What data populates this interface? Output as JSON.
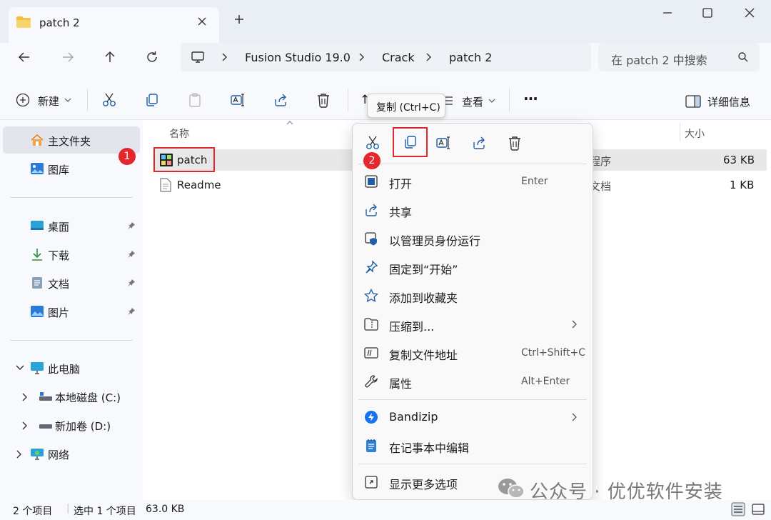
{
  "window": {
    "tab_title": "patch 2",
    "new_tab_symbol": "+"
  },
  "address": {
    "crumbs": [
      "Fusion Studio 19.0",
      "Crack",
      "patch 2"
    ],
    "search_placeholder": "在 patch 2 中搜索"
  },
  "toolbar": {
    "new_label": "新建",
    "sort_label": "↑",
    "view_label": "查看",
    "more_label": "···",
    "details_label": "详细信息"
  },
  "tooltip": {
    "text": "复制 (Ctrl+C)"
  },
  "sidebar": {
    "home": "主文件夹",
    "gallery": "图库",
    "desktop": "桌面",
    "downloads": "下载",
    "documents": "文档",
    "pictures": "图片",
    "this_pc": "此电脑",
    "drive_c": "本地磁盘 (C:)",
    "drive_d": "新加卷 (D:)",
    "network": "网络"
  },
  "files": {
    "header_name": "名称",
    "header_size": "大小",
    "rows": [
      {
        "name": "patch",
        "type": "程序",
        "size": "63 KB"
      },
      {
        "name": "Readme",
        "type": "文档",
        "size": "1 KB"
      }
    ]
  },
  "context_menu": {
    "items": [
      {
        "label": "打开",
        "shortcut": "Enter"
      },
      {
        "label": "共享",
        "shortcut": ""
      },
      {
        "label": "以管理员身份运行",
        "shortcut": ""
      },
      {
        "label": "固定到“开始”",
        "shortcut": ""
      },
      {
        "label": "添加到收藏夹",
        "shortcut": ""
      },
      {
        "label": "压缩到...",
        "shortcut": ""
      },
      {
        "label": "复制文件地址",
        "shortcut": "Ctrl+Shift+C"
      },
      {
        "label": "属性",
        "shortcut": "Alt+Enter"
      },
      {
        "label": "Bandizip",
        "shortcut": ""
      },
      {
        "label": "在记事本中编辑",
        "shortcut": ""
      },
      {
        "label": "显示更多选项",
        "shortcut": ""
      }
    ]
  },
  "annotations": {
    "step1": "1",
    "step2": "2"
  },
  "status": {
    "count": "2 个项目",
    "selected": "选中 1 个项目",
    "size": "63.0 KB"
  },
  "watermark": "公众号 · 优优软件安装",
  "colors": {
    "accent": "#0067c0",
    "annotation_red": "#e0292f",
    "folder_yellow": "#f3c043"
  }
}
